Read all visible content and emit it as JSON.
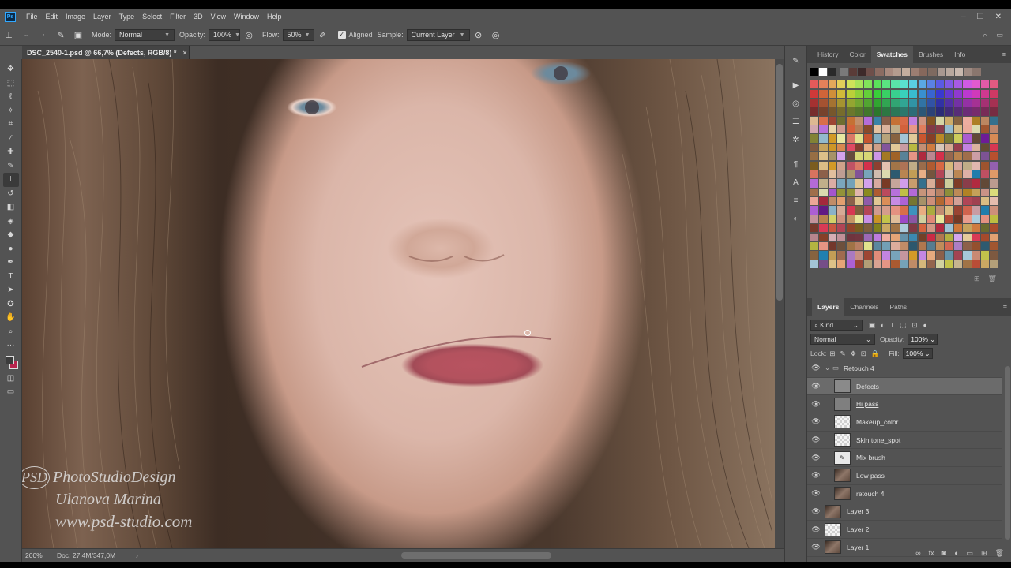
{
  "menubar": {
    "logo": "Ps",
    "items": [
      "File",
      "Edit",
      "Image",
      "Layer",
      "Type",
      "Select",
      "Filter",
      "3D",
      "View",
      "Window",
      "Help"
    ]
  },
  "options": {
    "mode_label": "Mode:",
    "mode_value": "Normal",
    "opacity_label": "Opacity:",
    "opacity_value": "100%",
    "flow_label": "Flow:",
    "flow_value": "50%",
    "aligned_label": "Aligned",
    "sample_label": "Sample:",
    "sample_value": "Current Layer"
  },
  "document": {
    "tab_title": "DSC_2540-1.psd @ 66,7% (Defects, RGB/8) *",
    "close": "×"
  },
  "watermark": {
    "logo": "PSD",
    "brand": "PhotoStudioDesign",
    "author": "Ulanova Marina",
    "url": "www.psd-studio.com"
  },
  "status": {
    "zoom": "200%",
    "doc": "Doc: 27,4M/347,0M"
  },
  "panels": {
    "top_tabs": [
      "History",
      "Color",
      "Swatches",
      "Brushes",
      "Info"
    ],
    "active_top_tab": "Swatches",
    "layer_tabs": [
      "Layers",
      "Channels",
      "Paths"
    ],
    "kind_label": "Kind",
    "blend_mode": "Normal",
    "opacity_label": "Opacity:",
    "opacity_value": "100%",
    "lock_label": "Lock:",
    "fill_label": "Fill:",
    "fill_value": "100%"
  },
  "layers": [
    {
      "name": "Retouch 4",
      "type": "group"
    },
    {
      "name": "Defects",
      "type": "check",
      "selected": true
    },
    {
      "name": "Hi pass",
      "type": "gray"
    },
    {
      "name": "Makeup_color",
      "type": "check"
    },
    {
      "name": "Skin tone_spot",
      "type": "check"
    },
    {
      "name": "Mix brush",
      "type": "brush"
    },
    {
      "name": "Low pass",
      "type": "photo"
    },
    {
      "name": "retouch 4",
      "type": "photo"
    },
    {
      "name": "Layer 3",
      "type": "photo"
    },
    {
      "name": "Layer 2",
      "type": "check"
    },
    {
      "name": "Layer 1",
      "type": "photo"
    }
  ],
  "colors": {
    "panel_bg": "#535353",
    "selected_layer": "#6b6b6b",
    "background_swatch": "#b8244c"
  }
}
